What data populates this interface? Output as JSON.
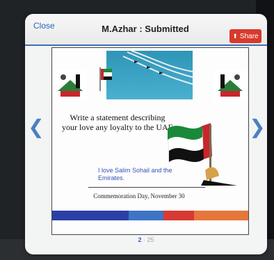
{
  "header": {
    "close_label": "Close",
    "title": "M.Azhar : Submitted",
    "share_label": "Share",
    "share_icon": "share-icon"
  },
  "card": {
    "prompt": "Write a statement describing your love any loyalty to the UAE",
    "answer": "I love Salim Sohail and the Emirates.",
    "footer_text": "Commemoration Day, November 30",
    "stripe_colors": [
      "#2b3fa7",
      "#3e74c6",
      "#d63a33",
      "#e6763b"
    ]
  },
  "navigation": {
    "prev_icon": "chevron-left-icon",
    "next_icon": "chevron-right-icon"
  },
  "pager": {
    "current": "2",
    "separator": "·",
    "total": "25"
  },
  "colors": {
    "accent_blue": "#3f6fb6",
    "share_red": "#d83a2b",
    "card_text_blue": "#3850b5"
  }
}
